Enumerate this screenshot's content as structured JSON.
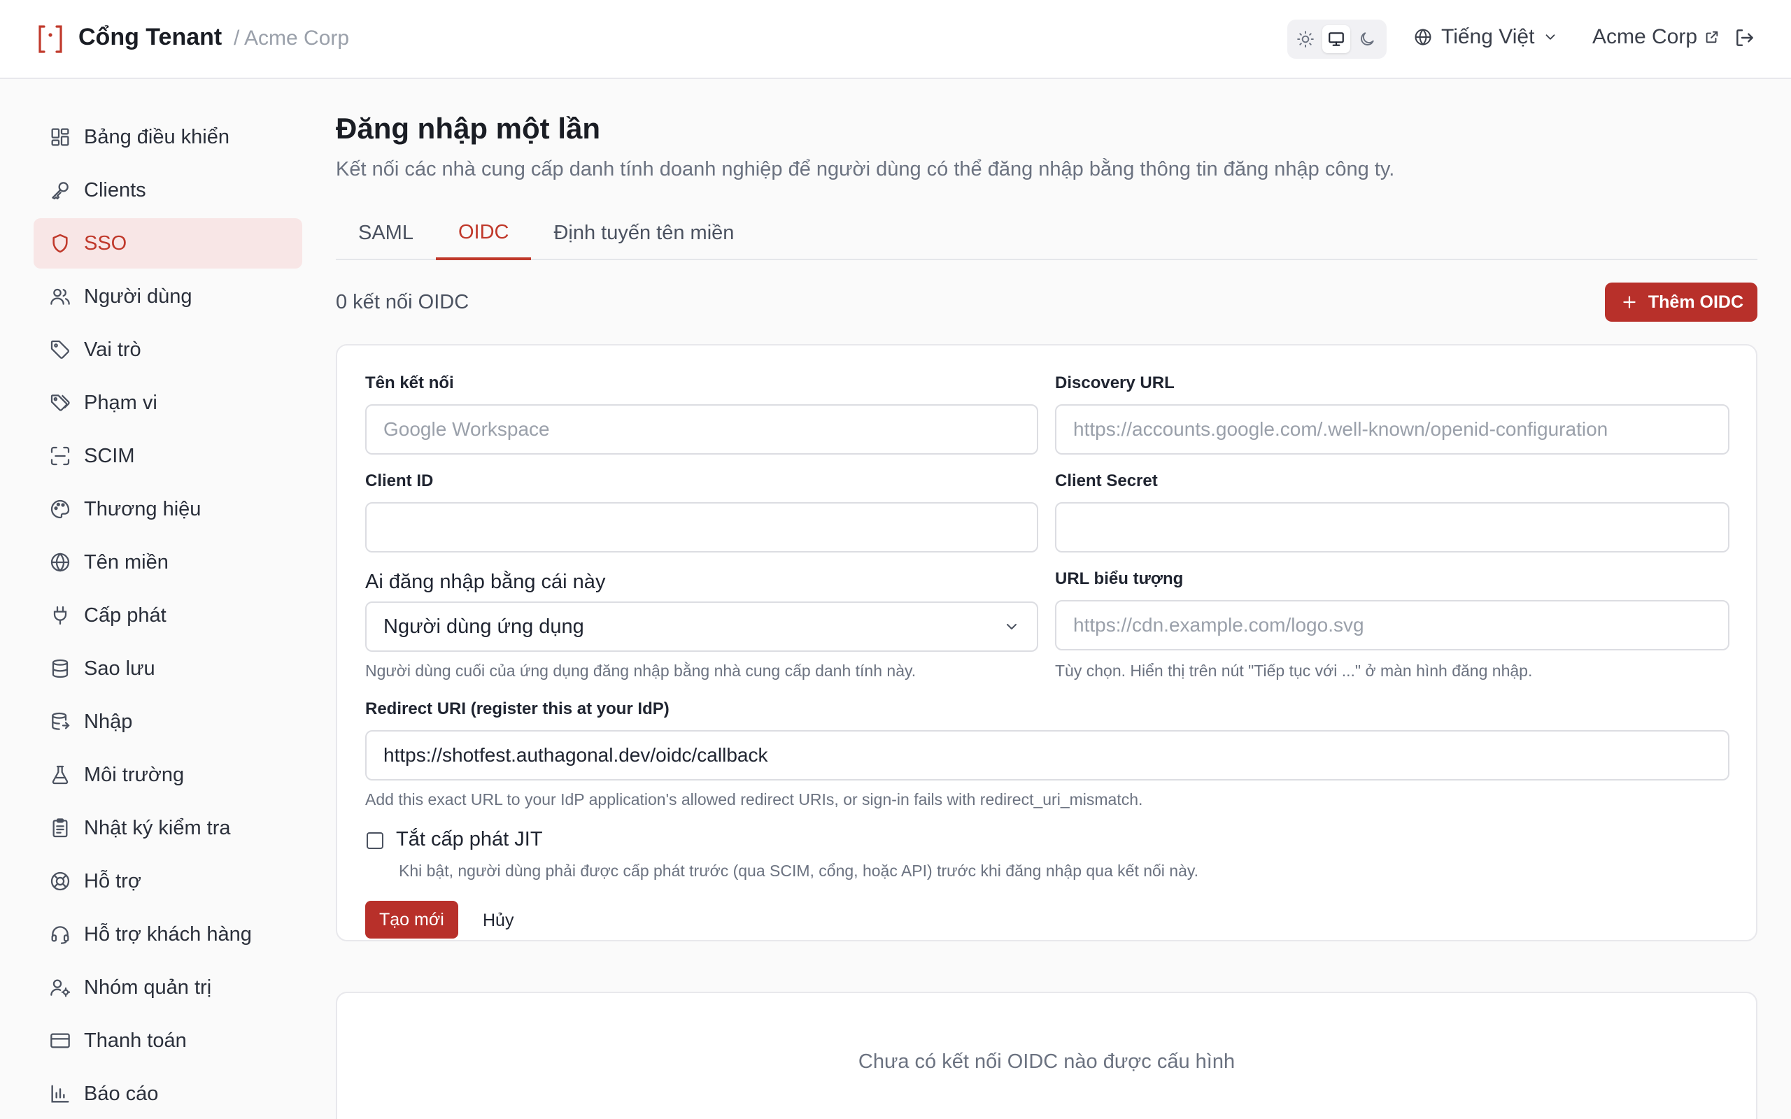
{
  "header": {
    "brand": "Cổng Tenant",
    "tenant_crumb": "/ Acme Corp",
    "language": "Tiếng Việt",
    "tenant_link": "Acme Corp"
  },
  "sidebar": {
    "items": [
      {
        "label": "Bảng điều khiển",
        "icon": "dashboard-icon"
      },
      {
        "label": "Clients",
        "icon": "key-icon"
      },
      {
        "label": "SSO",
        "icon": "shield-icon",
        "active": true
      },
      {
        "label": "Người dùng",
        "icon": "users-icon"
      },
      {
        "label": "Vai trò",
        "icon": "tag-icon"
      },
      {
        "label": "Phạm vi",
        "icon": "tags-icon"
      },
      {
        "label": "SCIM",
        "icon": "scan-icon"
      },
      {
        "label": "Thương hiệu",
        "icon": "palette-icon"
      },
      {
        "label": "Tên miền",
        "icon": "globe-icon"
      },
      {
        "label": "Cấp phát",
        "icon": "plug-icon"
      },
      {
        "label": "Sao lưu",
        "icon": "database-icon"
      },
      {
        "label": "Nhập",
        "icon": "import-icon"
      },
      {
        "label": "Môi trường",
        "icon": "flask-icon"
      },
      {
        "label": "Nhật ký kiểm tra",
        "icon": "clipboard-icon"
      },
      {
        "label": "Hỗ trợ",
        "icon": "lifebuoy-icon"
      },
      {
        "label": "Hỗ trợ khách hàng",
        "icon": "headset-icon"
      },
      {
        "label": "Nhóm quản trị",
        "icon": "user-cog-icon"
      },
      {
        "label": "Thanh toán",
        "icon": "credit-card-icon"
      },
      {
        "label": "Báo cáo",
        "icon": "bar-chart-icon"
      }
    ]
  },
  "main": {
    "title": "Đăng nhập một lần",
    "description": "Kết nối các nhà cung cấp danh tính doanh nghiệp để người dùng có thể đăng nhập bằng thông tin đăng nhập công ty.",
    "tabs": [
      {
        "label": "SAML"
      },
      {
        "label": "OIDC",
        "active": true
      },
      {
        "label": "Định tuyến tên miền"
      }
    ],
    "count_text": "0 kết nối OIDC",
    "add_button": "Thêm OIDC",
    "form": {
      "name_label": "Tên kết nối",
      "name_placeholder": "Google Workspace",
      "discovery_label": "Discovery URL",
      "discovery_placeholder": "https://accounts.google.com/.well-known/openid-configuration",
      "client_id_label": "Client ID",
      "client_id_value": "",
      "client_secret_label": "Client Secret",
      "client_secret_value": "",
      "audience_label": "Ai đăng nhập bằng cái này",
      "audience_value": "Người dùng ứng dụng",
      "audience_help": "Người dùng cuối của ứng dụng đăng nhập bằng nhà cung cấp danh tính này.",
      "logo_label": "URL biểu tượng",
      "logo_placeholder": "https://cdn.example.com/logo.svg",
      "logo_help": "Tùy chọn. Hiển thị trên nút \"Tiếp tục với ...\" ở màn hình đăng nhập.",
      "redirect_label": "Redirect URI (register this at your IdP)",
      "redirect_value": "https://shotfest.authagonal.dev/oidc/callback",
      "redirect_help": "Add this exact URL to your IdP application's allowed redirect URIs, or sign-in fails with redirect_uri_mismatch.",
      "jit_label": "Tắt cấp phát JIT",
      "jit_checked": false,
      "jit_help": "Khi bật, người dùng phải được cấp phát trước (qua SCIM, cổng, hoặc API) trước khi đăng nhập qua kết nối này.",
      "submit_label": "Tạo mới",
      "cancel_label": "Hủy"
    },
    "empty_text": "Chưa có kết nối OIDC nào được cấu hình"
  },
  "colors": {
    "accent": "#b8302a",
    "active_bg": "#f8e6e6"
  }
}
